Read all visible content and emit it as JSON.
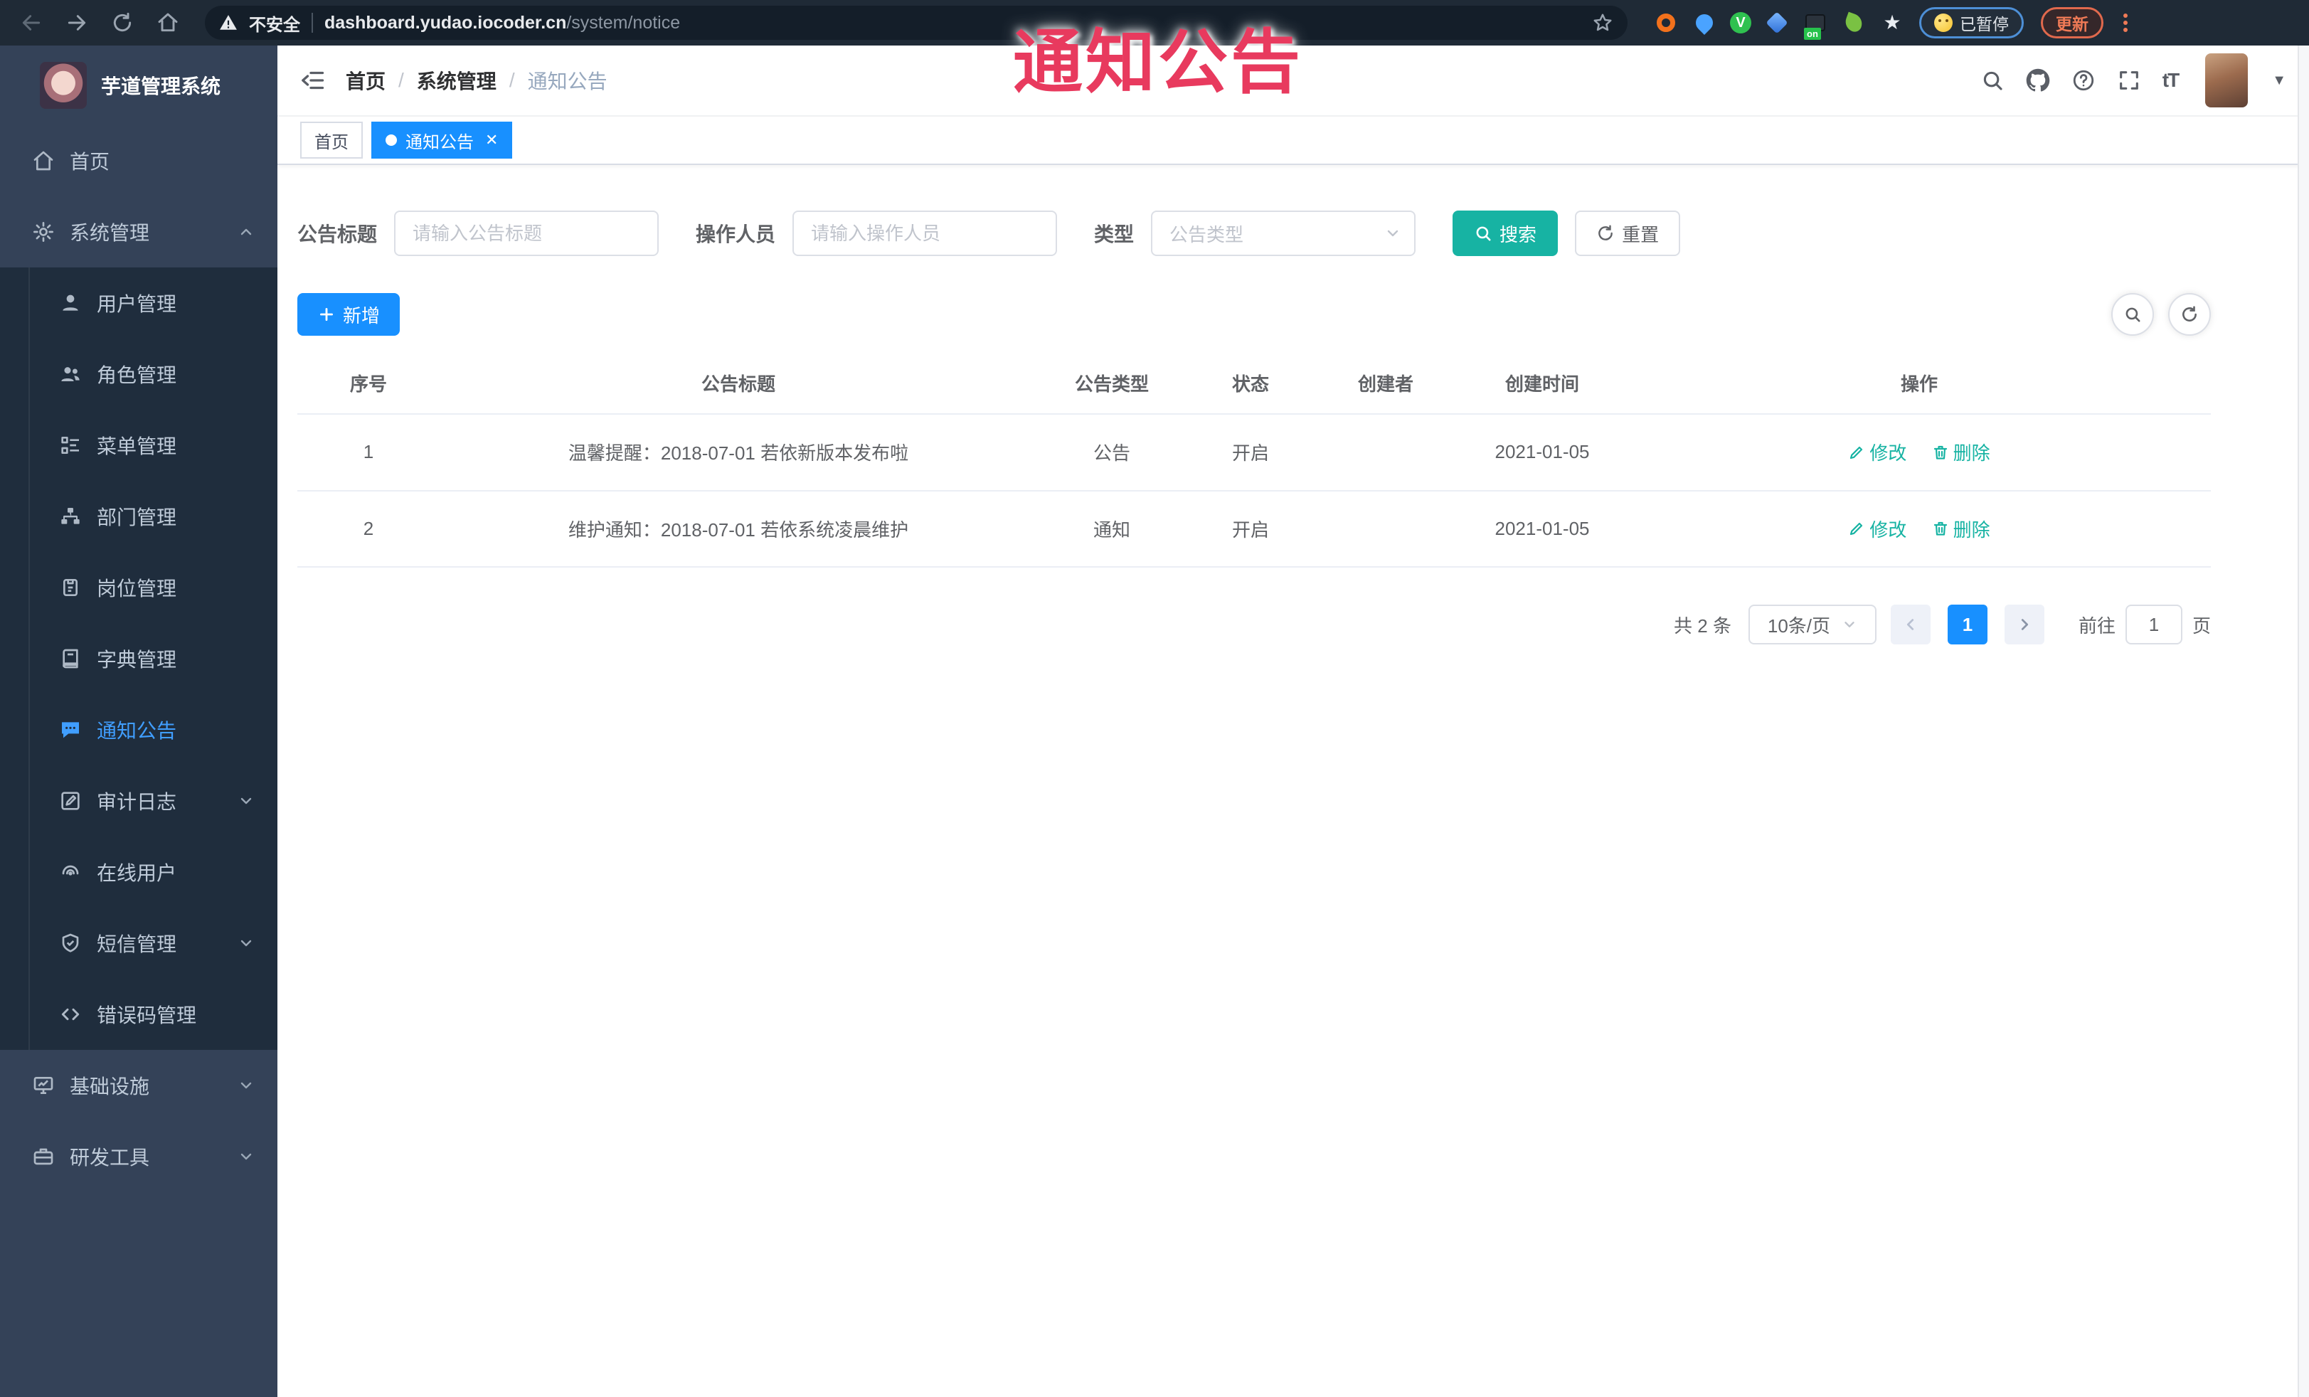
{
  "browser": {
    "security_label": "不安全",
    "url_host": "dashboard.yudao.iocoder.cn",
    "url_path": "/system/notice",
    "extension_badge": "on",
    "paused_label": "已暂停",
    "update_label": "更新"
  },
  "annotation": {
    "text": "通知公告",
    "color": "#e83a5e"
  },
  "sidebar": {
    "title": "芋道管理系统",
    "items": [
      {
        "label": "首页",
        "icon": "home-icon"
      },
      {
        "label": "系统管理",
        "icon": "gear-icon",
        "chevron": "up"
      },
      {
        "label": "用户管理",
        "icon": "user-icon",
        "sub": true
      },
      {
        "label": "角色管理",
        "icon": "users-icon",
        "sub": true
      },
      {
        "label": "菜单管理",
        "icon": "menu-tree-icon",
        "sub": true
      },
      {
        "label": "部门管理",
        "icon": "org-chart-icon",
        "sub": true
      },
      {
        "label": "岗位管理",
        "icon": "id-badge-icon",
        "sub": true
      },
      {
        "label": "字典管理",
        "icon": "dictionary-icon",
        "sub": true
      },
      {
        "label": "通知公告",
        "icon": "message-icon",
        "sub": true,
        "active": true
      },
      {
        "label": "审计日志",
        "icon": "audit-log-icon",
        "sub": true,
        "chevron": "down"
      },
      {
        "label": "在线用户",
        "icon": "online-user-icon",
        "sub": true
      },
      {
        "label": "短信管理",
        "icon": "sms-shield-icon",
        "sub": true,
        "chevron": "down"
      },
      {
        "label": "错误码管理",
        "icon": "code-icon",
        "sub": true
      },
      {
        "label": "基础设施",
        "icon": "monitor-icon",
        "chevron": "down"
      },
      {
        "label": "研发工具",
        "icon": "toolbox-icon",
        "chevron": "down"
      }
    ]
  },
  "header": {
    "breadcrumb": [
      "首页",
      "系统管理",
      "通知公告"
    ]
  },
  "tabs": [
    {
      "label": "首页",
      "active": false
    },
    {
      "label": "通知公告",
      "active": true
    }
  ],
  "filters": {
    "title_label": "公告标题",
    "title_placeholder": "请输入公告标题",
    "operator_label": "操作人员",
    "operator_placeholder": "请输入操作人员",
    "type_label": "类型",
    "type_placeholder": "公告类型",
    "search_label": "搜索",
    "reset_label": "重置"
  },
  "toolbar": {
    "add_label": "新增"
  },
  "table": {
    "headers": [
      "序号",
      "公告标题",
      "公告类型",
      "状态",
      "创建者",
      "创建时间",
      "操作"
    ],
    "edit_label": "修改",
    "delete_label": "删除",
    "rows": [
      {
        "no": "1",
        "title": "温馨提醒：2018-07-01 若依新版本发布啦",
        "type": "公告",
        "status": "开启",
        "creator": "",
        "created": "2021-01-05"
      },
      {
        "no": "2",
        "title": "维护通知：2018-07-01 若依系统凌晨维护",
        "type": "通知",
        "status": "开启",
        "creator": "",
        "created": "2021-01-05"
      }
    ]
  },
  "pagination": {
    "total": "共 2 条",
    "page_size": "10条/页",
    "page": "1",
    "goto": "前往",
    "goto_value": "1",
    "unit": "页"
  },
  "colors": {
    "primary": "#1890ff",
    "active_menu": "#409eff",
    "teal": "#17b3a3",
    "annotation_red": "#e83a5e"
  }
}
